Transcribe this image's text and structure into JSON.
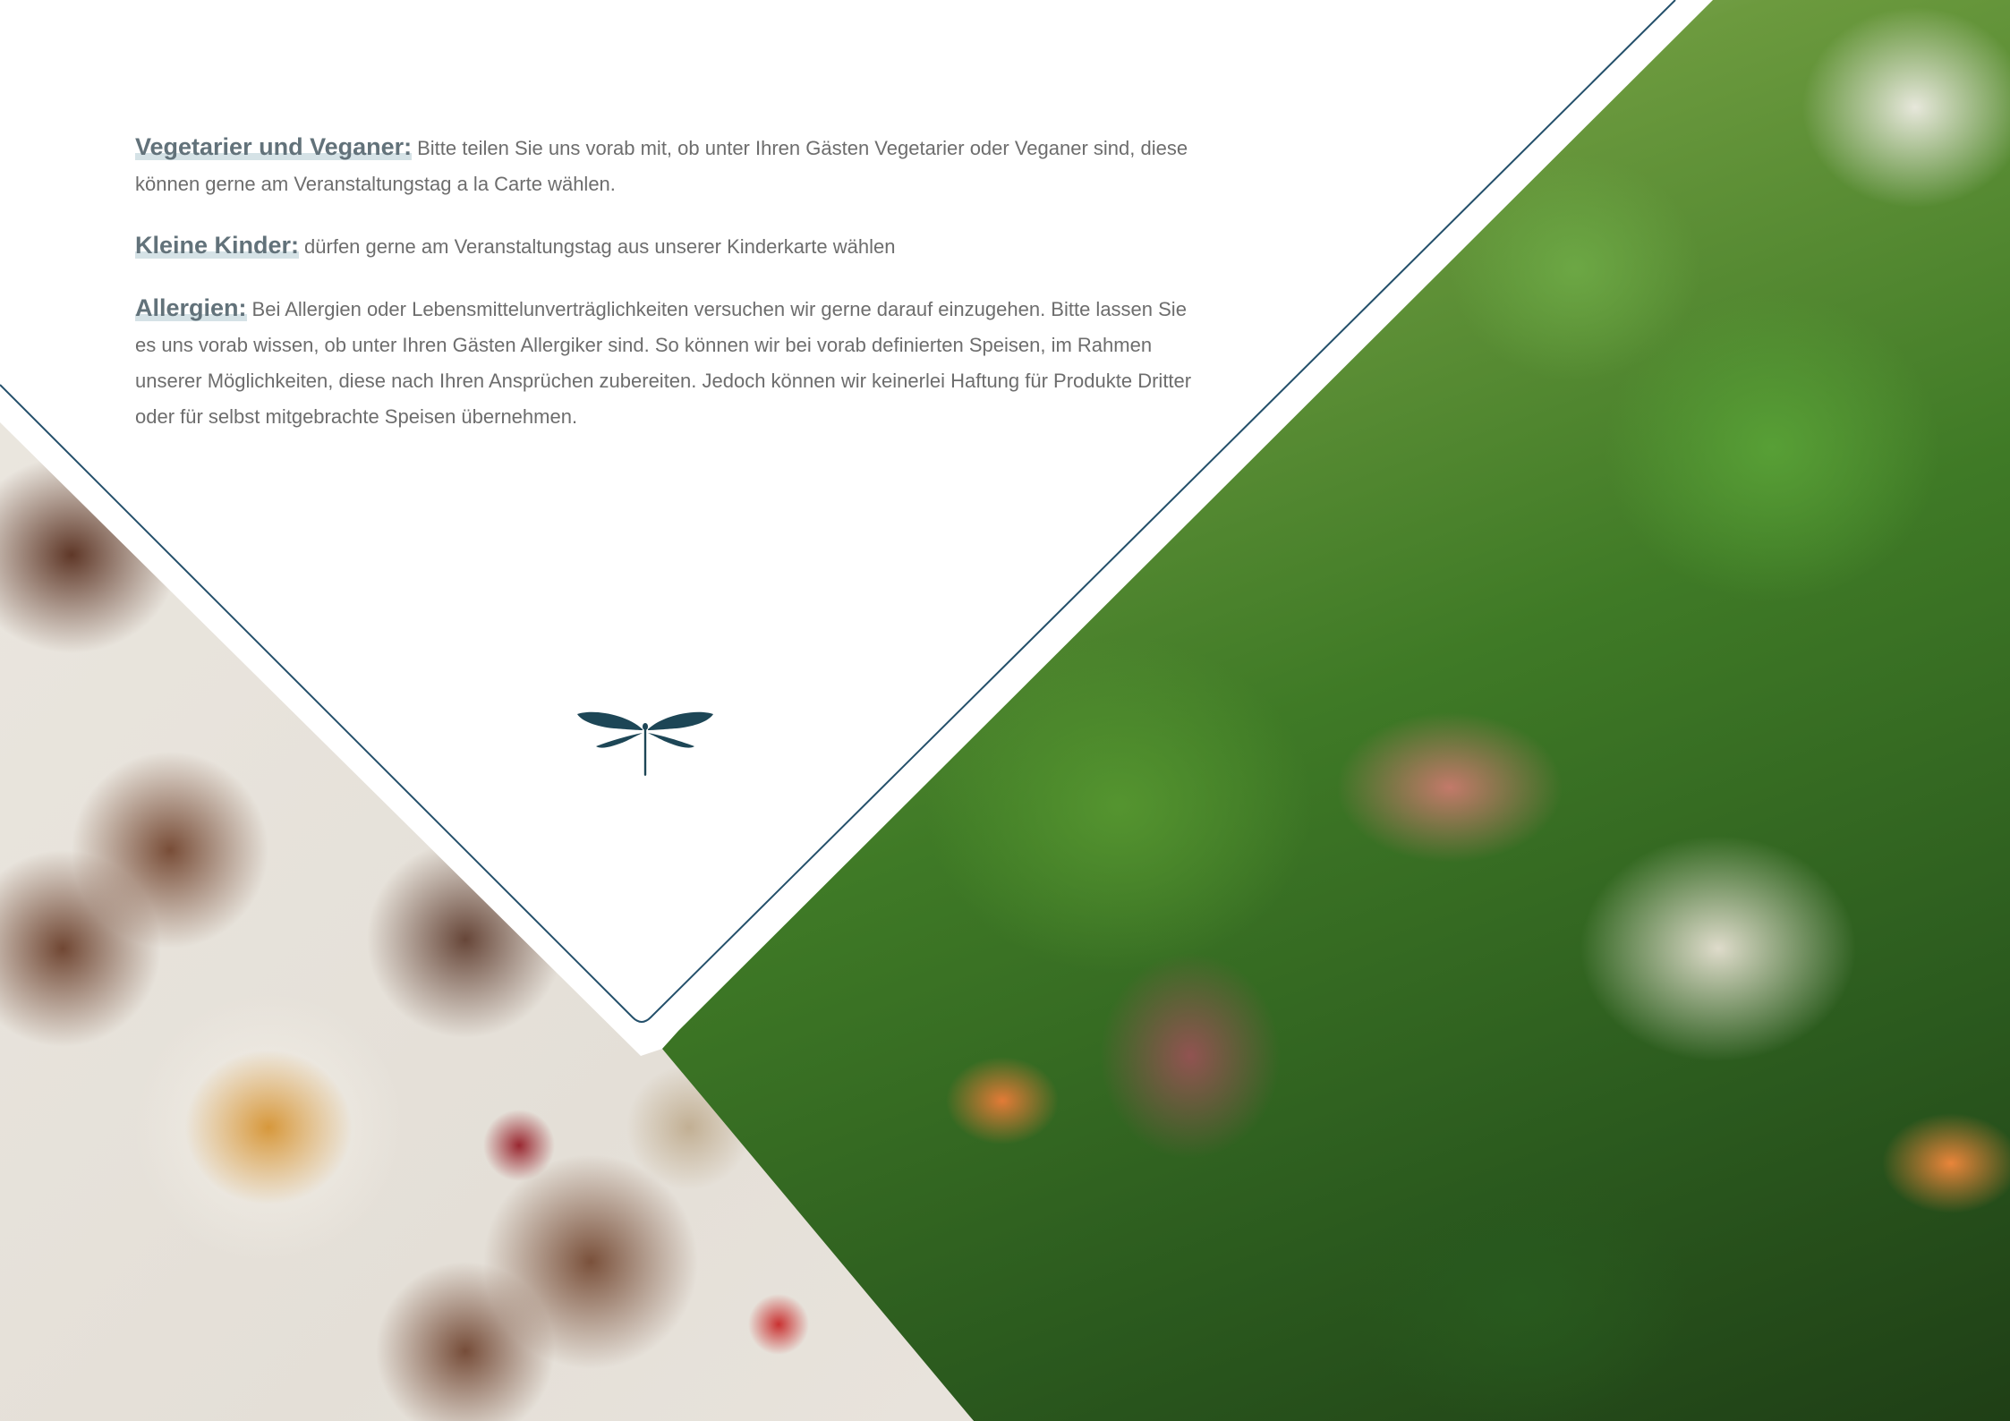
{
  "sections": [
    {
      "label": "Vegetarier und Veganer:",
      "text": "Bitte teilen Sie uns vorab mit, ob unter Ihren Gästen Vegetarier oder Veganer sind, diese können gerne am Veranstaltungstag a la Carte wählen."
    },
    {
      "label": "Kleine Kinder:",
      "text": "dürfen gerne am Veranstaltungstag aus unserer Kinderkarte wählen"
    },
    {
      "label": "Allergien:",
      "text": "Bei Allergien oder Lebensmittelunverträglichkeiten versuchen wir gerne darauf einzugehen. Bitte lassen Sie es uns vorab wissen, ob unter Ihren Gästen Allergiker sind. So können wir bei vorab definierten Speisen, im Rahmen unserer Möglichkeiten, diese nach Ihren Ansprüchen zubereiten.  Jedoch können wir keinerlei Haftung für Produkte Dritter oder für selbst mitgebrachte Speisen übernehmen."
    }
  ],
  "images": {
    "right_photo": "octopus-salad-photo",
    "left_photo": "dessert-table-photo",
    "logo": "dragonfly-logo"
  },
  "colors": {
    "text": "#6d6d6d",
    "label": "#62727a",
    "label_highlight": "#d5e2e6",
    "divider_line": "#24506b",
    "logo": "#1d4656"
  }
}
